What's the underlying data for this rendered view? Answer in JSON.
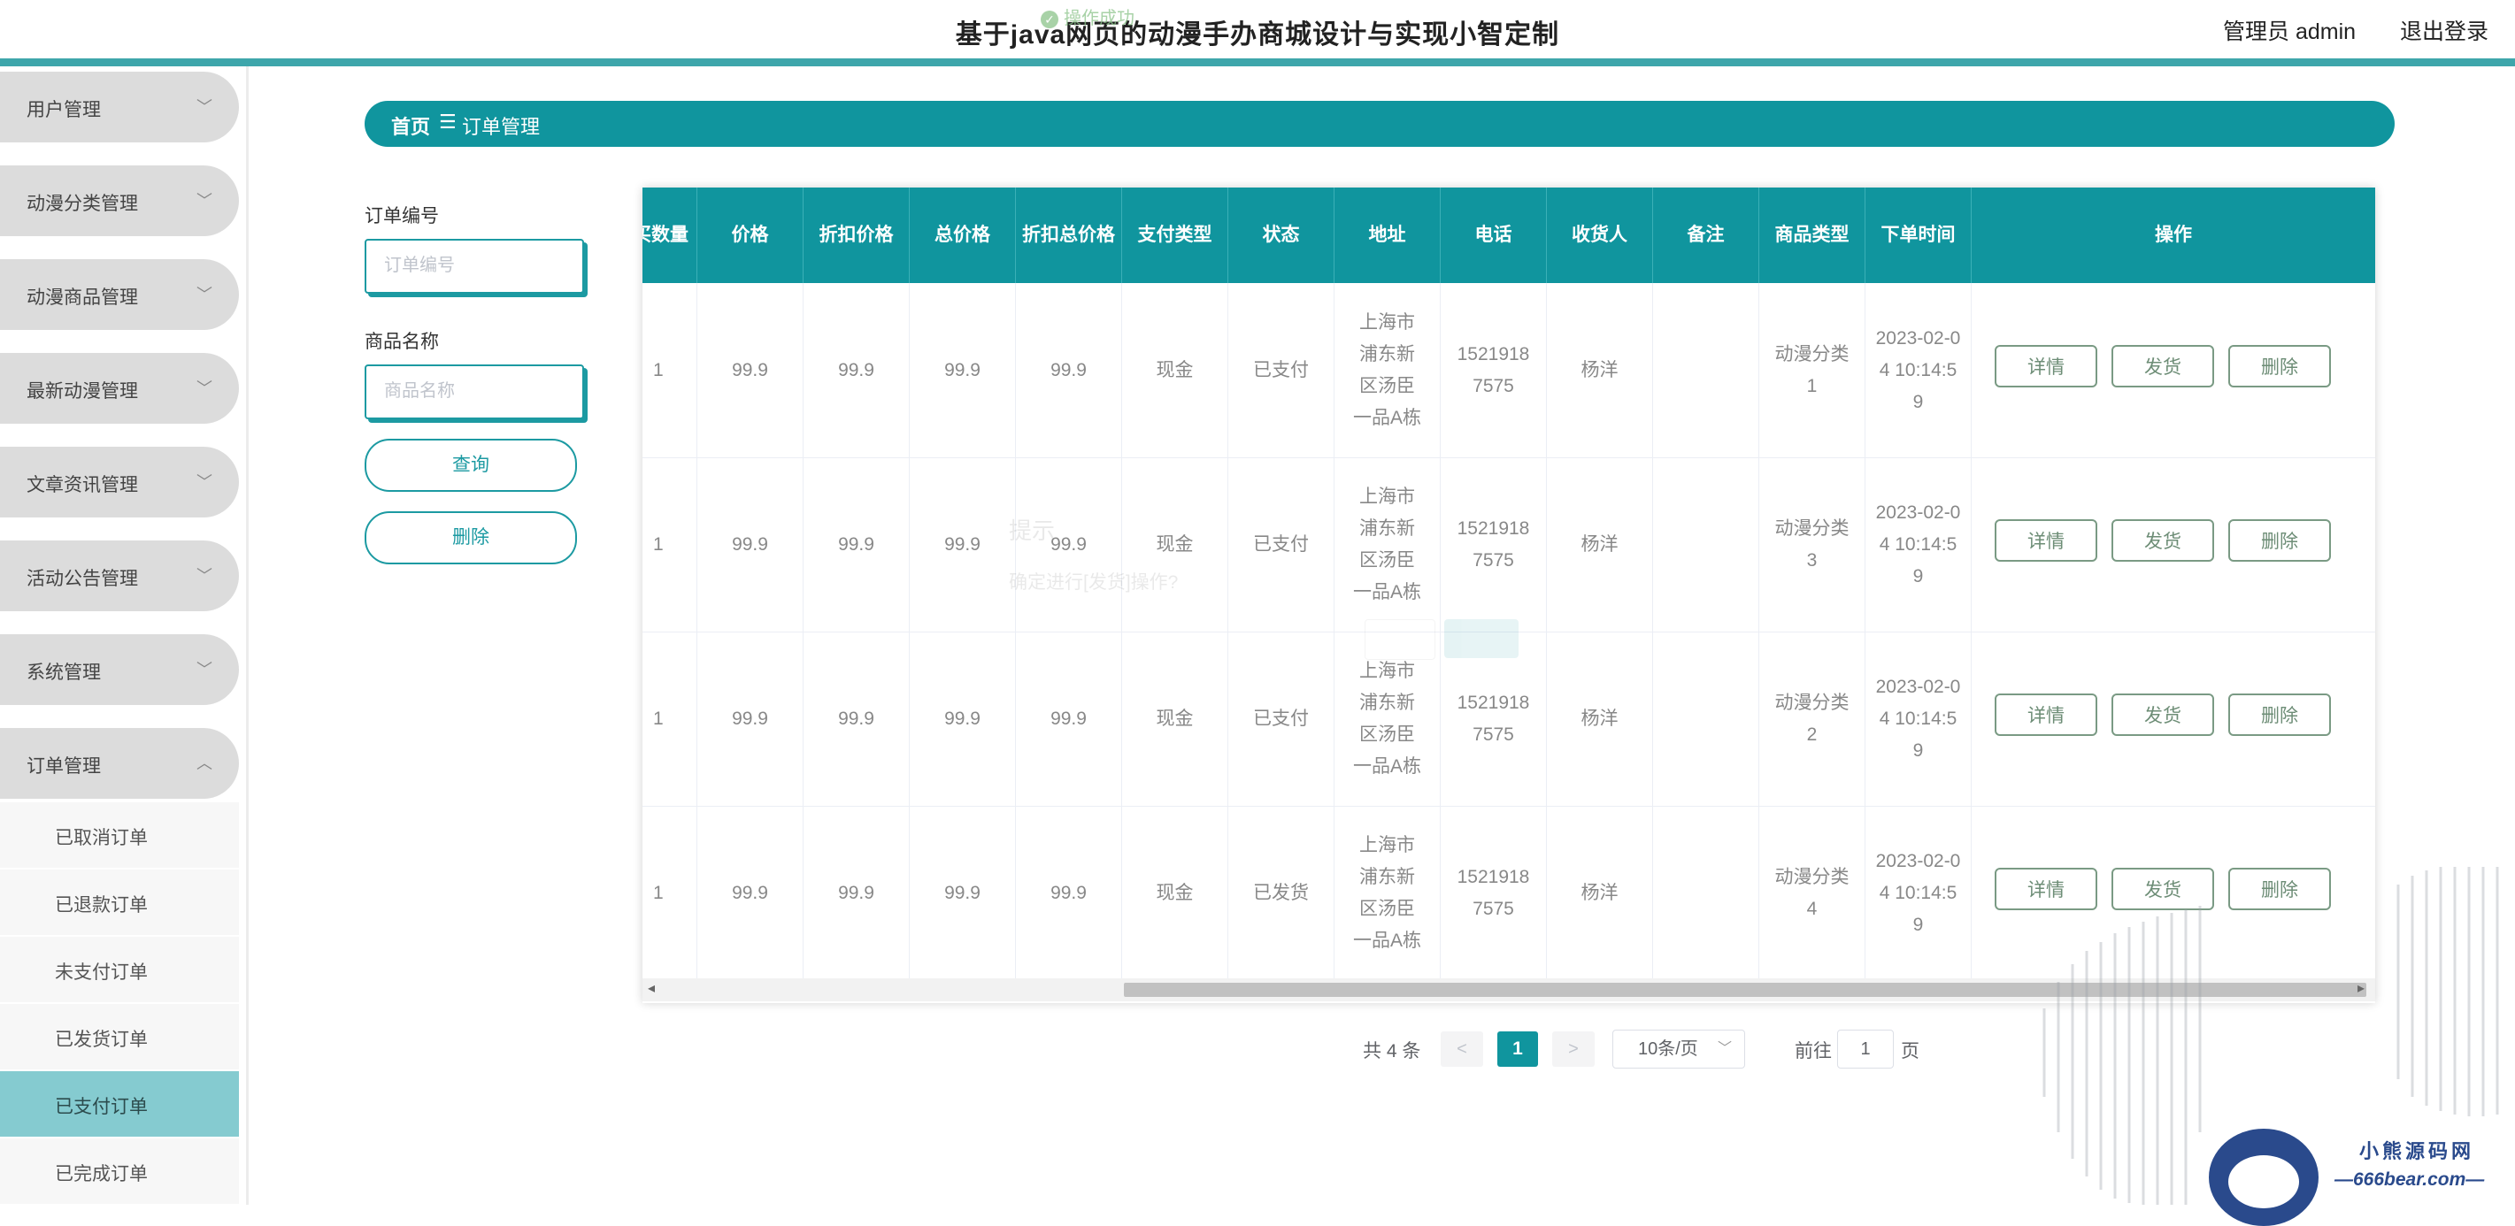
{
  "header": {
    "title": "基于java网页的动漫手办商城设计与实现小智定制",
    "toast": "操作成功",
    "admin": "管理员 admin",
    "logout": "退出登录"
  },
  "sidebar": {
    "groups": [
      {
        "label": "用户管理",
        "icon": "chevron-down"
      },
      {
        "label": "动漫分类管理",
        "icon": "chevron-down"
      },
      {
        "label": "动漫商品管理",
        "icon": "chevron-down"
      },
      {
        "label": "最新动漫管理",
        "icon": "chevron-down"
      },
      {
        "label": "文章资讯管理",
        "icon": "chevron-down"
      },
      {
        "label": "活动公告管理",
        "icon": "chevron-down"
      },
      {
        "label": "系统管理",
        "icon": "chevron-down"
      },
      {
        "label": "订单管理",
        "icon": "chevron-up"
      }
    ],
    "sub_items": [
      {
        "label": "已取消订单"
      },
      {
        "label": "已退款订单"
      },
      {
        "label": "未支付订单"
      },
      {
        "label": "已发货订单"
      },
      {
        "label": "已支付订单",
        "active": true
      },
      {
        "label": "已完成订单"
      }
    ],
    "active_color": "#85cbd0"
  },
  "breadcrumb": {
    "home": "首页",
    "separator": "☰",
    "current": "订单管理"
  },
  "filters": {
    "order_no": {
      "label": "订单编号",
      "placeholder": "订单编号",
      "value": ""
    },
    "product_name": {
      "label": "商品名称",
      "placeholder": "商品名称",
      "value": ""
    },
    "query_button": "查询",
    "delete_button": "删除"
  },
  "table": {
    "columns": [
      "买数量",
      "价格",
      "折扣价格",
      "总价格",
      "折扣总价格",
      "支付类型",
      "状态",
      "地址",
      "电话",
      "收货人",
      "备注",
      "商品类型",
      "下单时间",
      "操作"
    ],
    "rows": [
      {
        "qty": "1",
        "price": "99.9",
        "disc_price": "99.9",
        "total": "99.9",
        "disc_total": "99.9",
        "pay_type": "现金",
        "status": "已支付",
        "address": "上海市浦东新区汤臣一品A栋",
        "phone": "15219187575",
        "receiver": "杨洋",
        "note": "",
        "category": "动漫分类1",
        "time": "2023-02-04 10:14:59"
      },
      {
        "qty": "1",
        "price": "99.9",
        "disc_price": "99.9",
        "total": "99.9",
        "disc_total": "99.9",
        "pay_type": "现金",
        "status": "已支付",
        "address": "上海市浦东新区汤臣一品A栋",
        "phone": "15219187575",
        "receiver": "杨洋",
        "note": "",
        "category": "动漫分类3",
        "time": "2023-02-04 10:14:59"
      },
      {
        "qty": "1",
        "price": "99.9",
        "disc_price": "99.9",
        "total": "99.9",
        "disc_total": "99.9",
        "pay_type": "现金",
        "status": "已支付",
        "address": "上海市浦东新区汤臣一品A栋",
        "phone": "15219187575",
        "receiver": "杨洋",
        "note": "",
        "category": "动漫分类2",
        "time": "2023-02-04 10:14:59"
      },
      {
        "qty": "1",
        "price": "99.9",
        "disc_price": "99.9",
        "total": "99.9",
        "disc_total": "99.9",
        "pay_type": "现金",
        "status": "已发货",
        "address": "上海市浦东新区汤臣一品A栋",
        "phone": "15219187575",
        "receiver": "杨洋",
        "note": "",
        "category": "动漫分类4",
        "time": "2023-02-04 10:14:59"
      }
    ],
    "actions": {
      "detail": "详情",
      "ship": "发货",
      "delete": "删除"
    },
    "header_color": "#10959e"
  },
  "pagination": {
    "total": "共 4 条",
    "prev": "<",
    "current": "1",
    "next": ">",
    "page_size": "10条/页",
    "goto_prefix": "前往",
    "goto_value": "1",
    "goto_suffix": "页"
  },
  "dialog_ghost": {
    "title": "提示",
    "message": "确定进行[发货]操作?"
  },
  "watermark": {
    "name": "小熊源码网",
    "url": "—666bear.com—"
  }
}
